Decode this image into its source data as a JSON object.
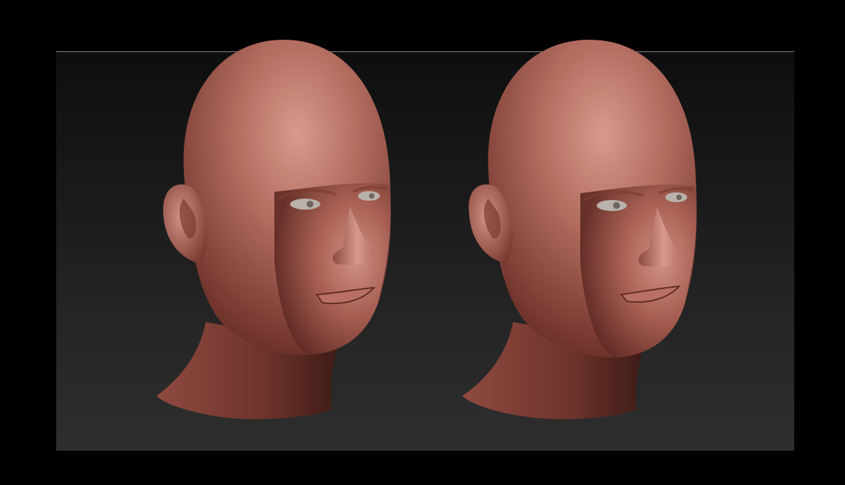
{
  "app": {
    "title": "",
    "background_color": "#000000",
    "viewport_top_color": "#0e0e0e",
    "viewport_bottom_color": "#2e2e2e",
    "separator_color": "#8a8a8a"
  },
  "scene": {
    "objects": [
      {
        "name": "head-sculpt-left",
        "material": "clay-red"
      },
      {
        "name": "head-sculpt-right",
        "material": "clay-red"
      }
    ],
    "material_colors": {
      "base": "#a0574e",
      "highlight": "#d99a8c",
      "shadow": "#4a211c",
      "eye": "#b9b2ac"
    }
  }
}
